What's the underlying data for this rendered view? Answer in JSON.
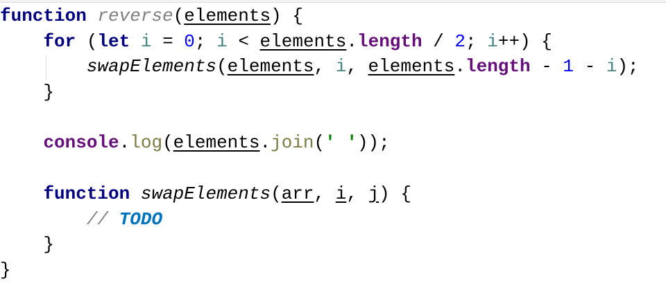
{
  "lines": [
    {
      "tokens": [
        {
          "t": "function",
          "c": "kw"
        },
        {
          "t": " ",
          "c": "plain"
        },
        {
          "t": "reverse",
          "c": "fnname"
        },
        {
          "t": "(",
          "c": "plain"
        },
        {
          "t": "elements",
          "c": "param"
        },
        {
          "t": ") {",
          "c": "plain"
        }
      ]
    },
    {
      "tokens": [
        {
          "t": "    ",
          "c": "plain"
        },
        {
          "t": "for",
          "c": "kw"
        },
        {
          "t": " (",
          "c": "plain"
        },
        {
          "t": "let",
          "c": "kw"
        },
        {
          "t": " ",
          "c": "plain"
        },
        {
          "t": "i",
          "c": "var"
        },
        {
          "t": " = ",
          "c": "plain"
        },
        {
          "t": "0",
          "c": "num"
        },
        {
          "t": "; ",
          "c": "plain"
        },
        {
          "t": "i",
          "c": "var"
        },
        {
          "t": " < ",
          "c": "plain"
        },
        {
          "t": "elements",
          "c": "param"
        },
        {
          "t": ".",
          "c": "plain"
        },
        {
          "t": "length",
          "c": "prop"
        },
        {
          "t": " / ",
          "c": "plain"
        },
        {
          "t": "2",
          "c": "num"
        },
        {
          "t": "; ",
          "c": "plain"
        },
        {
          "t": "i",
          "c": "var"
        },
        {
          "t": "++) {",
          "c": "plain"
        }
      ]
    },
    {
      "tokens": [
        {
          "t": "        ",
          "c": "plain"
        },
        {
          "t": "swapElements",
          "c": "fncall"
        },
        {
          "t": "(",
          "c": "plain"
        },
        {
          "t": "elements",
          "c": "param"
        },
        {
          "t": ", ",
          "c": "plain"
        },
        {
          "t": "i",
          "c": "var"
        },
        {
          "t": ", ",
          "c": "plain"
        },
        {
          "t": "elements",
          "c": "param"
        },
        {
          "t": ".",
          "c": "plain"
        },
        {
          "t": "length",
          "c": "prop"
        },
        {
          "t": " - ",
          "c": "plain"
        },
        {
          "t": "1",
          "c": "num"
        },
        {
          "t": " - ",
          "c": "plain"
        },
        {
          "t": "i",
          "c": "var"
        },
        {
          "t": ");",
          "c": "plain"
        }
      ]
    },
    {
      "tokens": [
        {
          "t": "    }",
          "c": "plain"
        }
      ]
    },
    {
      "tokens": []
    },
    {
      "tokens": [
        {
          "t": "    ",
          "c": "plain"
        },
        {
          "t": "console",
          "c": "prop"
        },
        {
          "t": ".",
          "c": "plain"
        },
        {
          "t": "log",
          "c": "method"
        },
        {
          "t": "(",
          "c": "plain"
        },
        {
          "t": "elements",
          "c": "param"
        },
        {
          "t": ".",
          "c": "plain"
        },
        {
          "t": "join",
          "c": "method"
        },
        {
          "t": "(",
          "c": "plain"
        },
        {
          "t": "' '",
          "c": "str"
        },
        {
          "t": "));",
          "c": "plain"
        }
      ]
    },
    {
      "tokens": []
    },
    {
      "tokens": [
        {
          "t": "    ",
          "c": "plain"
        },
        {
          "t": "function",
          "c": "kw"
        },
        {
          "t": " ",
          "c": "plain"
        },
        {
          "t": "swapElements",
          "c": "fncall"
        },
        {
          "t": "(",
          "c": "plain"
        },
        {
          "t": "arr",
          "c": "param"
        },
        {
          "t": ", ",
          "c": "plain"
        },
        {
          "t": "i",
          "c": "param"
        },
        {
          "t": ", ",
          "c": "plain"
        },
        {
          "t": "j",
          "c": "param"
        },
        {
          "t": ") {",
          "c": "plain"
        }
      ]
    },
    {
      "tokens": [
        {
          "t": "        ",
          "c": "plain"
        },
        {
          "t": "// ",
          "c": "cmt"
        },
        {
          "t": "TODO",
          "c": "todo"
        }
      ]
    },
    {
      "tokens": [
        {
          "t": "    }",
          "c": "plain"
        }
      ]
    },
    {
      "tokens": [
        {
          "t": "}",
          "c": "plain"
        }
      ]
    }
  ]
}
